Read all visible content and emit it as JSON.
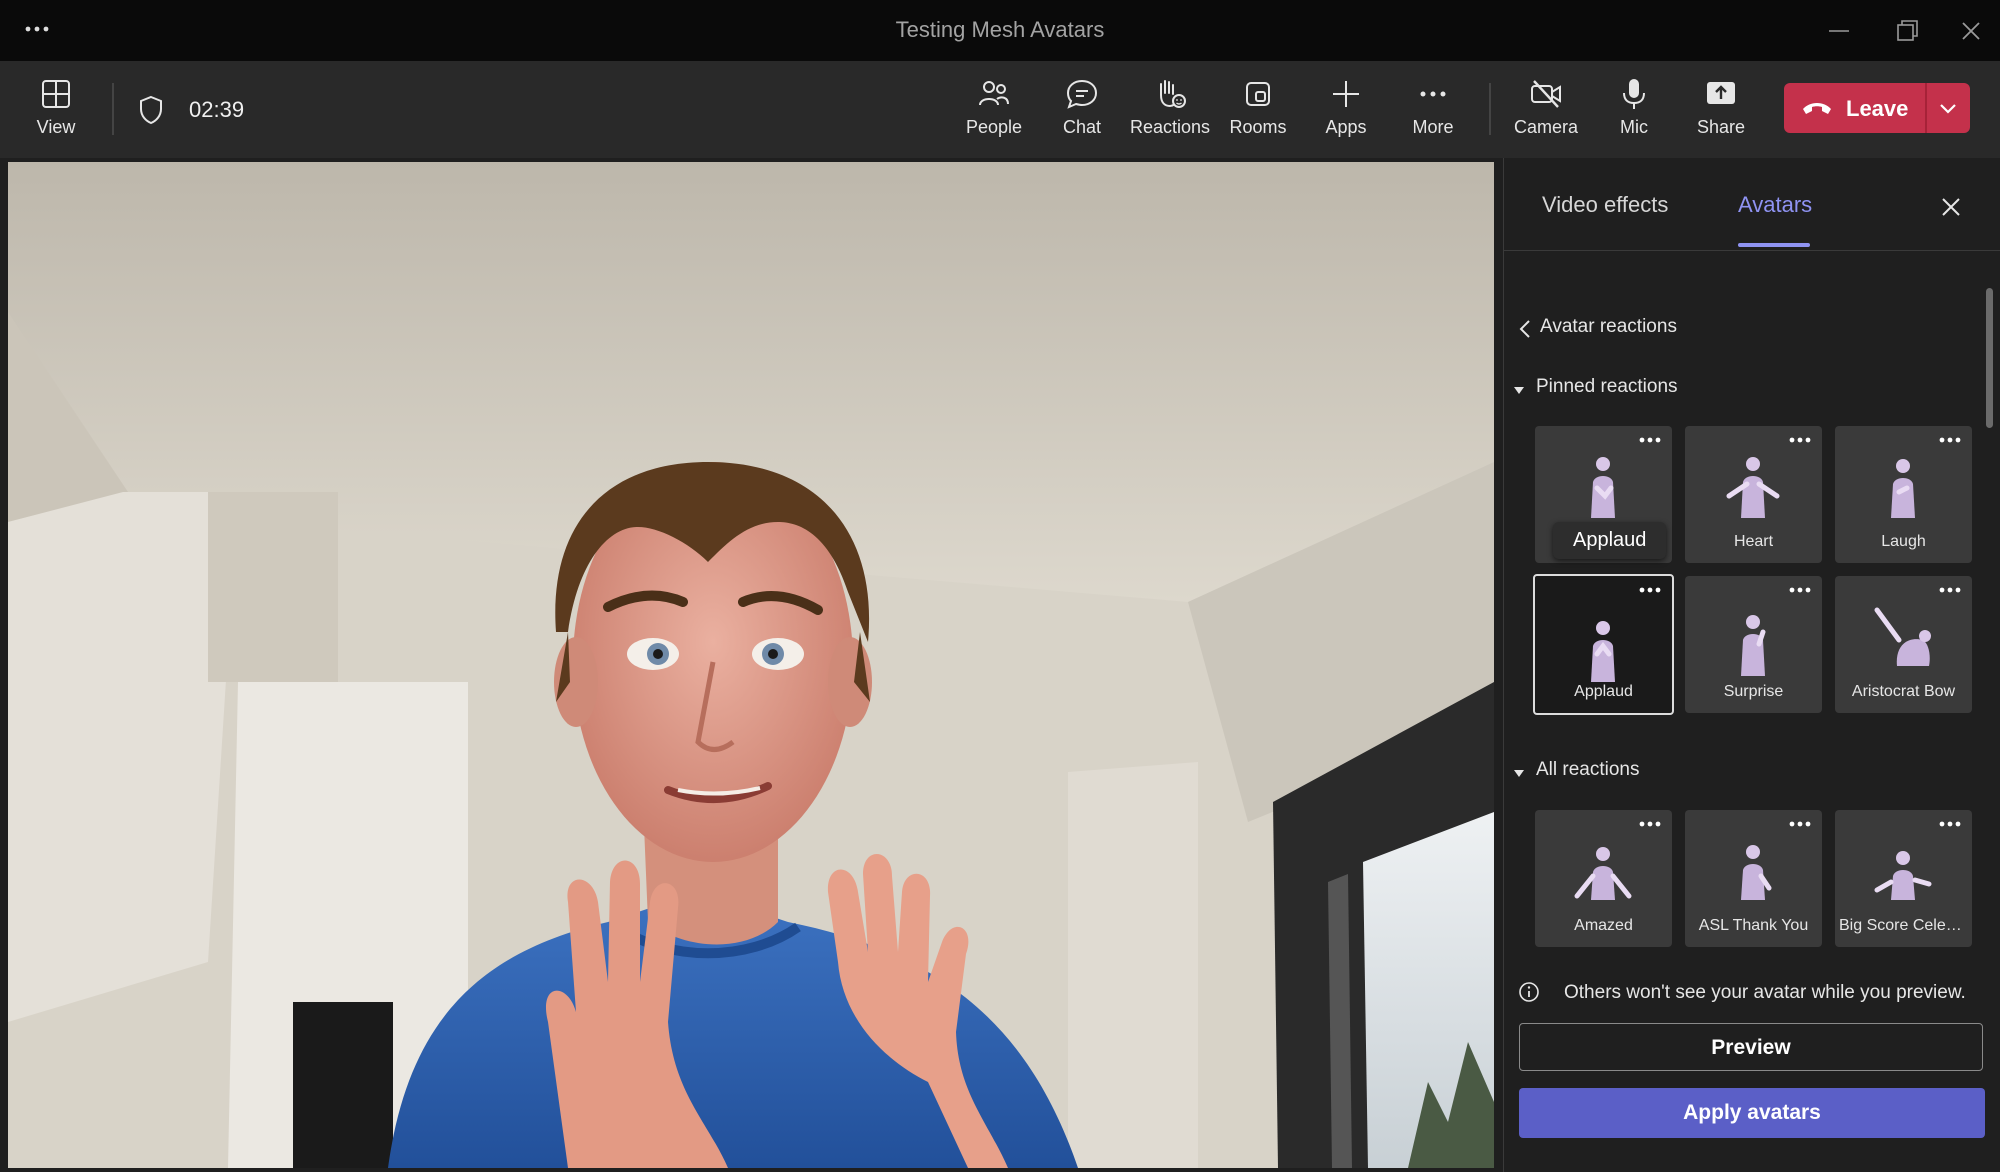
{
  "window": {
    "title": "Testing Mesh Avatars",
    "more_icon": "more-horizontal-icon",
    "controls": [
      "minimize-icon",
      "restore-icon",
      "close-icon"
    ]
  },
  "toolbar": {
    "view_label": "View",
    "timer": "02:39",
    "people_label": "People",
    "chat_label": "Chat",
    "reactions_label": "Reactions",
    "rooms_label": "Rooms",
    "apps_label": "Apps",
    "more_label": "More",
    "camera_label": "Camera",
    "mic_label": "Mic",
    "share_label": "Share",
    "leave_label": "Leave"
  },
  "panel": {
    "tabs": [
      {
        "label": "Video effects",
        "active": false
      },
      {
        "label": "Avatars",
        "active": true
      }
    ],
    "back_label": "Avatar reactions",
    "pinned": {
      "heading": "Pinned reactions",
      "tooltip": "Applaud",
      "items": [
        {
          "label": "Applaud",
          "selected": false
        },
        {
          "label": "Heart",
          "selected": false
        },
        {
          "label": "Laugh",
          "selected": false
        },
        {
          "label": "Applaud",
          "selected": true
        },
        {
          "label": "Surprise",
          "selected": false
        },
        {
          "label": "Aristocrat Bow",
          "selected": false
        }
      ]
    },
    "all": {
      "heading": "All reactions",
      "items": [
        {
          "label": "Amazed"
        },
        {
          "label": "ASL Thank You"
        },
        {
          "label": "Big Score Celebr..."
        }
      ]
    },
    "info_text": "Others won't see your avatar while you preview.",
    "preview_label": "Preview",
    "apply_label": "Apply avatars"
  },
  "colors": {
    "accent": "#5b5fc7",
    "accent_text": "#8f93f2",
    "leave": "#c4314b",
    "panel_bg": "#1f1f1f",
    "toolbar_bg": "#292929"
  }
}
